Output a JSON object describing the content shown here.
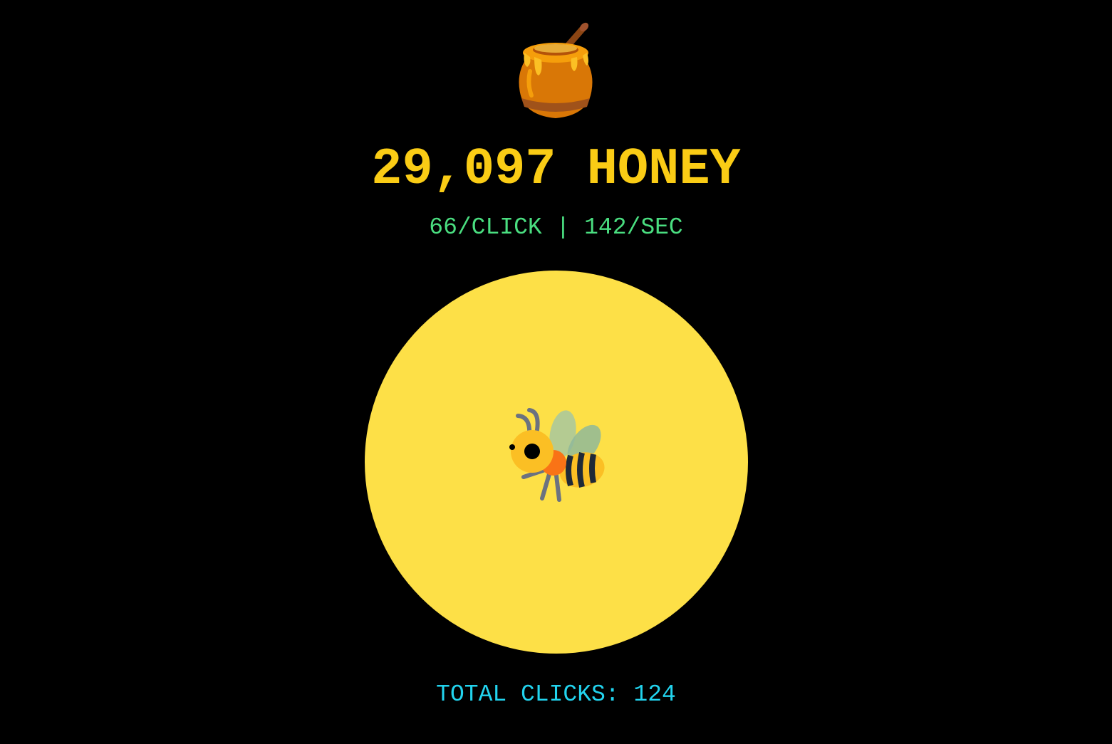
{
  "header": {
    "pot_icon": "honey-pot-icon",
    "honey_label": "29,097 HONEY",
    "rates_label": "66/CLICK | 142/SEC"
  },
  "clicker": {
    "icon": "bee-icon"
  },
  "footer": {
    "total_clicks_label": "TOTAL CLICKS: 124"
  },
  "colors": {
    "background": "#000000",
    "honey_text": "#FACC15",
    "rates_text": "#4ADE80",
    "total_text": "#22D3EE",
    "circle": "#FDE047"
  }
}
